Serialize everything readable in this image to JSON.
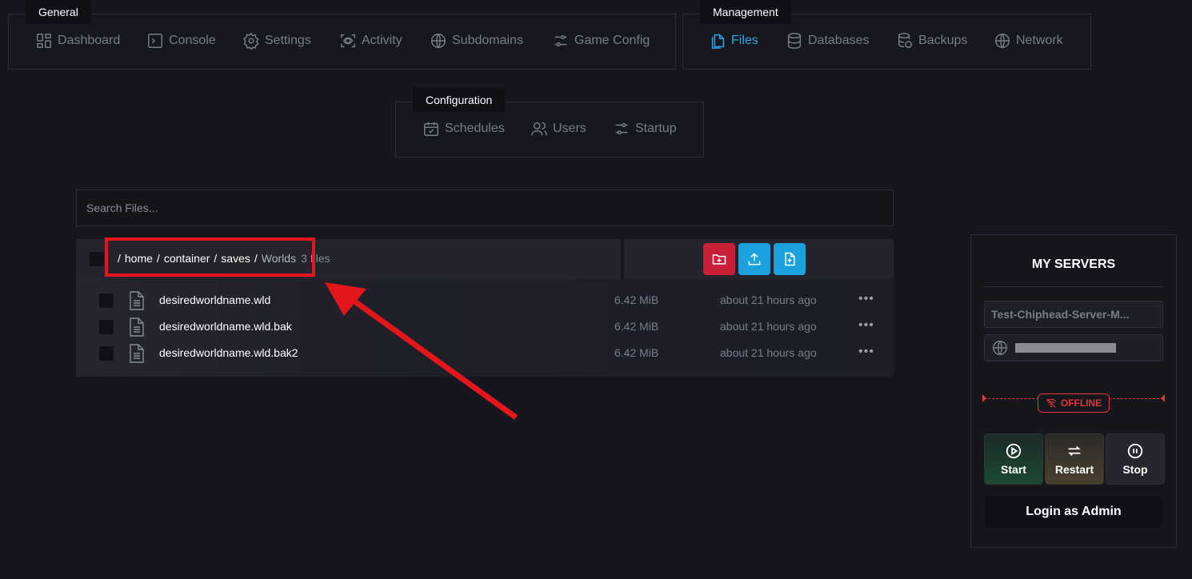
{
  "nav": {
    "general": {
      "title": "General",
      "items": [
        {
          "label": "Dashboard",
          "icon": "dashboard-icon"
        },
        {
          "label": "Console",
          "icon": "console-icon"
        },
        {
          "label": "Settings",
          "icon": "gear-icon"
        },
        {
          "label": "Activity",
          "icon": "activity-icon"
        },
        {
          "label": "Subdomains",
          "icon": "globe-icon"
        },
        {
          "label": "Game Config",
          "icon": "sliders-icon"
        }
      ]
    },
    "management": {
      "title": "Management",
      "items": [
        {
          "label": "Files",
          "icon": "files-icon",
          "active": true
        },
        {
          "label": "Databases",
          "icon": "database-icon"
        },
        {
          "label": "Backups",
          "icon": "backup-icon"
        },
        {
          "label": "Network",
          "icon": "globe-icon"
        }
      ]
    },
    "configuration": {
      "title": "Configuration",
      "items": [
        {
          "label": "Schedules",
          "icon": "calendar-icon"
        },
        {
          "label": "Users",
          "icon": "users-icon"
        },
        {
          "label": "Startup",
          "icon": "sliders-icon"
        }
      ]
    }
  },
  "search": {
    "placeholder": "Search Files..."
  },
  "breadcrumb": {
    "segments": [
      "home",
      "container",
      "saves"
    ],
    "current": "Worlds",
    "count": "3 files"
  },
  "actions": {
    "create_folder_color": "#c9203a",
    "upload_color": "#1ba1dd",
    "new_file_color": "#1ba1dd"
  },
  "files": [
    {
      "name": "desiredworldname.wld",
      "size": "6.42 MiB",
      "modified": "about 21 hours ago"
    },
    {
      "name": "desiredworldname.wld.bak",
      "size": "6.42 MiB",
      "modified": "about 21 hours ago"
    },
    {
      "name": "desiredworldname.wld.bak2",
      "size": "6.42 MiB",
      "modified": "about 21 hours ago"
    }
  ],
  "servers": {
    "title": "MY SERVERS",
    "server_name": "Test-Chiphead-Server-M...",
    "status": "OFFLINE",
    "status_color": "#e0383c",
    "controls": {
      "start": "Start",
      "restart": "Restart",
      "stop": "Stop"
    },
    "login": "Login as Admin"
  },
  "annotation": {
    "color": "#e3161b"
  }
}
